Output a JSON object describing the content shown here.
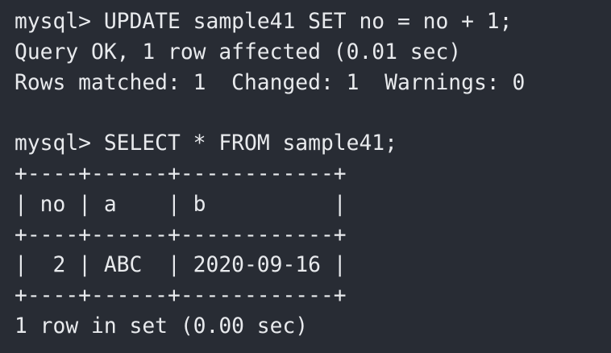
{
  "terminal": {
    "lines": [
      {
        "kind": "command",
        "prompt": "mysql> ",
        "text": "UPDATE sample41 SET no = no + 1;"
      },
      {
        "kind": "output",
        "text": "Query OK, 1 row affected (0.01 sec)"
      },
      {
        "kind": "output",
        "text": "Rows matched: 1  Changed: 1  Warnings: 0"
      },
      {
        "kind": "blank",
        "text": ""
      },
      {
        "kind": "command",
        "prompt": "mysql> ",
        "text": "SELECT * FROM sample41;"
      },
      {
        "kind": "table-border",
        "text": "+----+------+------------+"
      },
      {
        "kind": "table-header",
        "text": "| no | a    | b          |"
      },
      {
        "kind": "table-border",
        "text": "+----+------+------------+"
      },
      {
        "kind": "table-row",
        "text": "|  2 | ABC  | 2020-09-16 |"
      },
      {
        "kind": "table-border",
        "text": "+----+------+------------+"
      },
      {
        "kind": "output",
        "text": "1 row in set (0.00 sec)"
      }
    ]
  },
  "colors": {
    "background": "#282c34",
    "foreground": "#e8eaed"
  }
}
